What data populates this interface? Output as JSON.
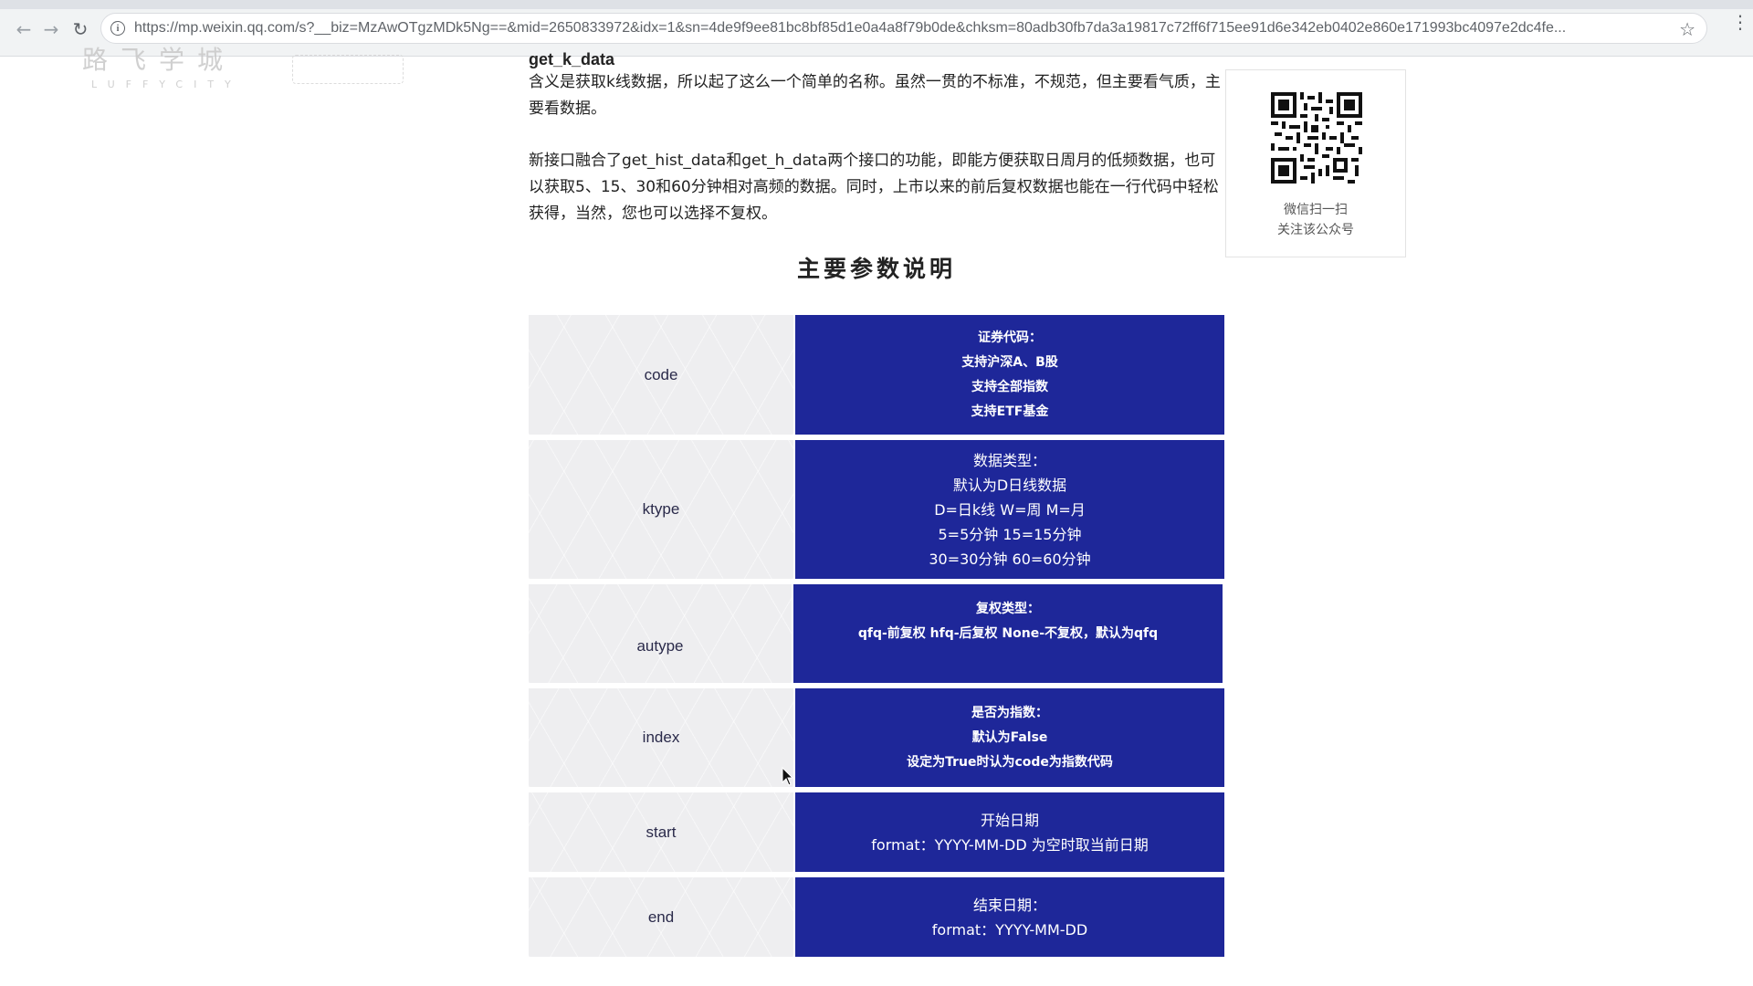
{
  "browser": {
    "url": "https://mp.weixin.qq.com/s?__biz=MzAwOTgzMDk5Ng==&mid=2650833972&idx=1&sn=4de9f9ee81bc8bf85d1e0a4a8f79b0de&chksm=80adb30fb7da3a19817c72ff6f715ee91d6e342eb0402e860e171993bc4097e2dc4fe..."
  },
  "watermark": {
    "title": "路飞学城",
    "subtitle": "LUFFYCITY"
  },
  "article": {
    "function_name": "get_k_data",
    "paragraph1": "含义是获取k线数据，所以起了这么一个简单的名称。虽然一贯的不标准，不规范，但主要看气质，主要看数据。",
    "paragraph2": "新接口融合了get_hist_data和get_h_data两个接口的功能，即能方便获取日周月的低频数据，也可以获取5、15、30和60分钟相对高频的数据。同时，上市以来的前后复权数据也能在一行代码中轻松获得，当然，您也可以选择不复权。",
    "section_title": "主要参数说明"
  },
  "qr_panel": {
    "caption_line1": "微信扫一扫",
    "caption_line2": "关注该公众号"
  },
  "params": [
    {
      "name": "code",
      "lines": [
        "证券代码：",
        "支持沪深A、B股",
        "支持全部指数",
        "支持ETF基金"
      ]
    },
    {
      "name": "ktype",
      "lines": [
        "数据类型：",
        "默认为D日线数据",
        "D=日k线 W=周 M=月",
        "5=5分钟 15=15分钟",
        "30=30分钟 60=60分钟"
      ]
    },
    {
      "name": "autype",
      "lines": [
        "复权类型：",
        "qfq-前复权 hfq-后复权 None-不复权，默认为qfq"
      ]
    },
    {
      "name": "index",
      "lines": [
        "是否为指数：",
        "默认为False",
        "设定为True时认为code为指数代码"
      ]
    },
    {
      "name": "start",
      "lines": [
        "开始日期",
        "format：YYYY-MM-DD 为空时取当前日期"
      ]
    },
    {
      "name": "end",
      "lines": [
        "结束日期：",
        "format：YYYY-MM-DD"
      ]
    }
  ],
  "colors": {
    "desc_background": "#1e2799",
    "name_background": "#eeeef0"
  }
}
